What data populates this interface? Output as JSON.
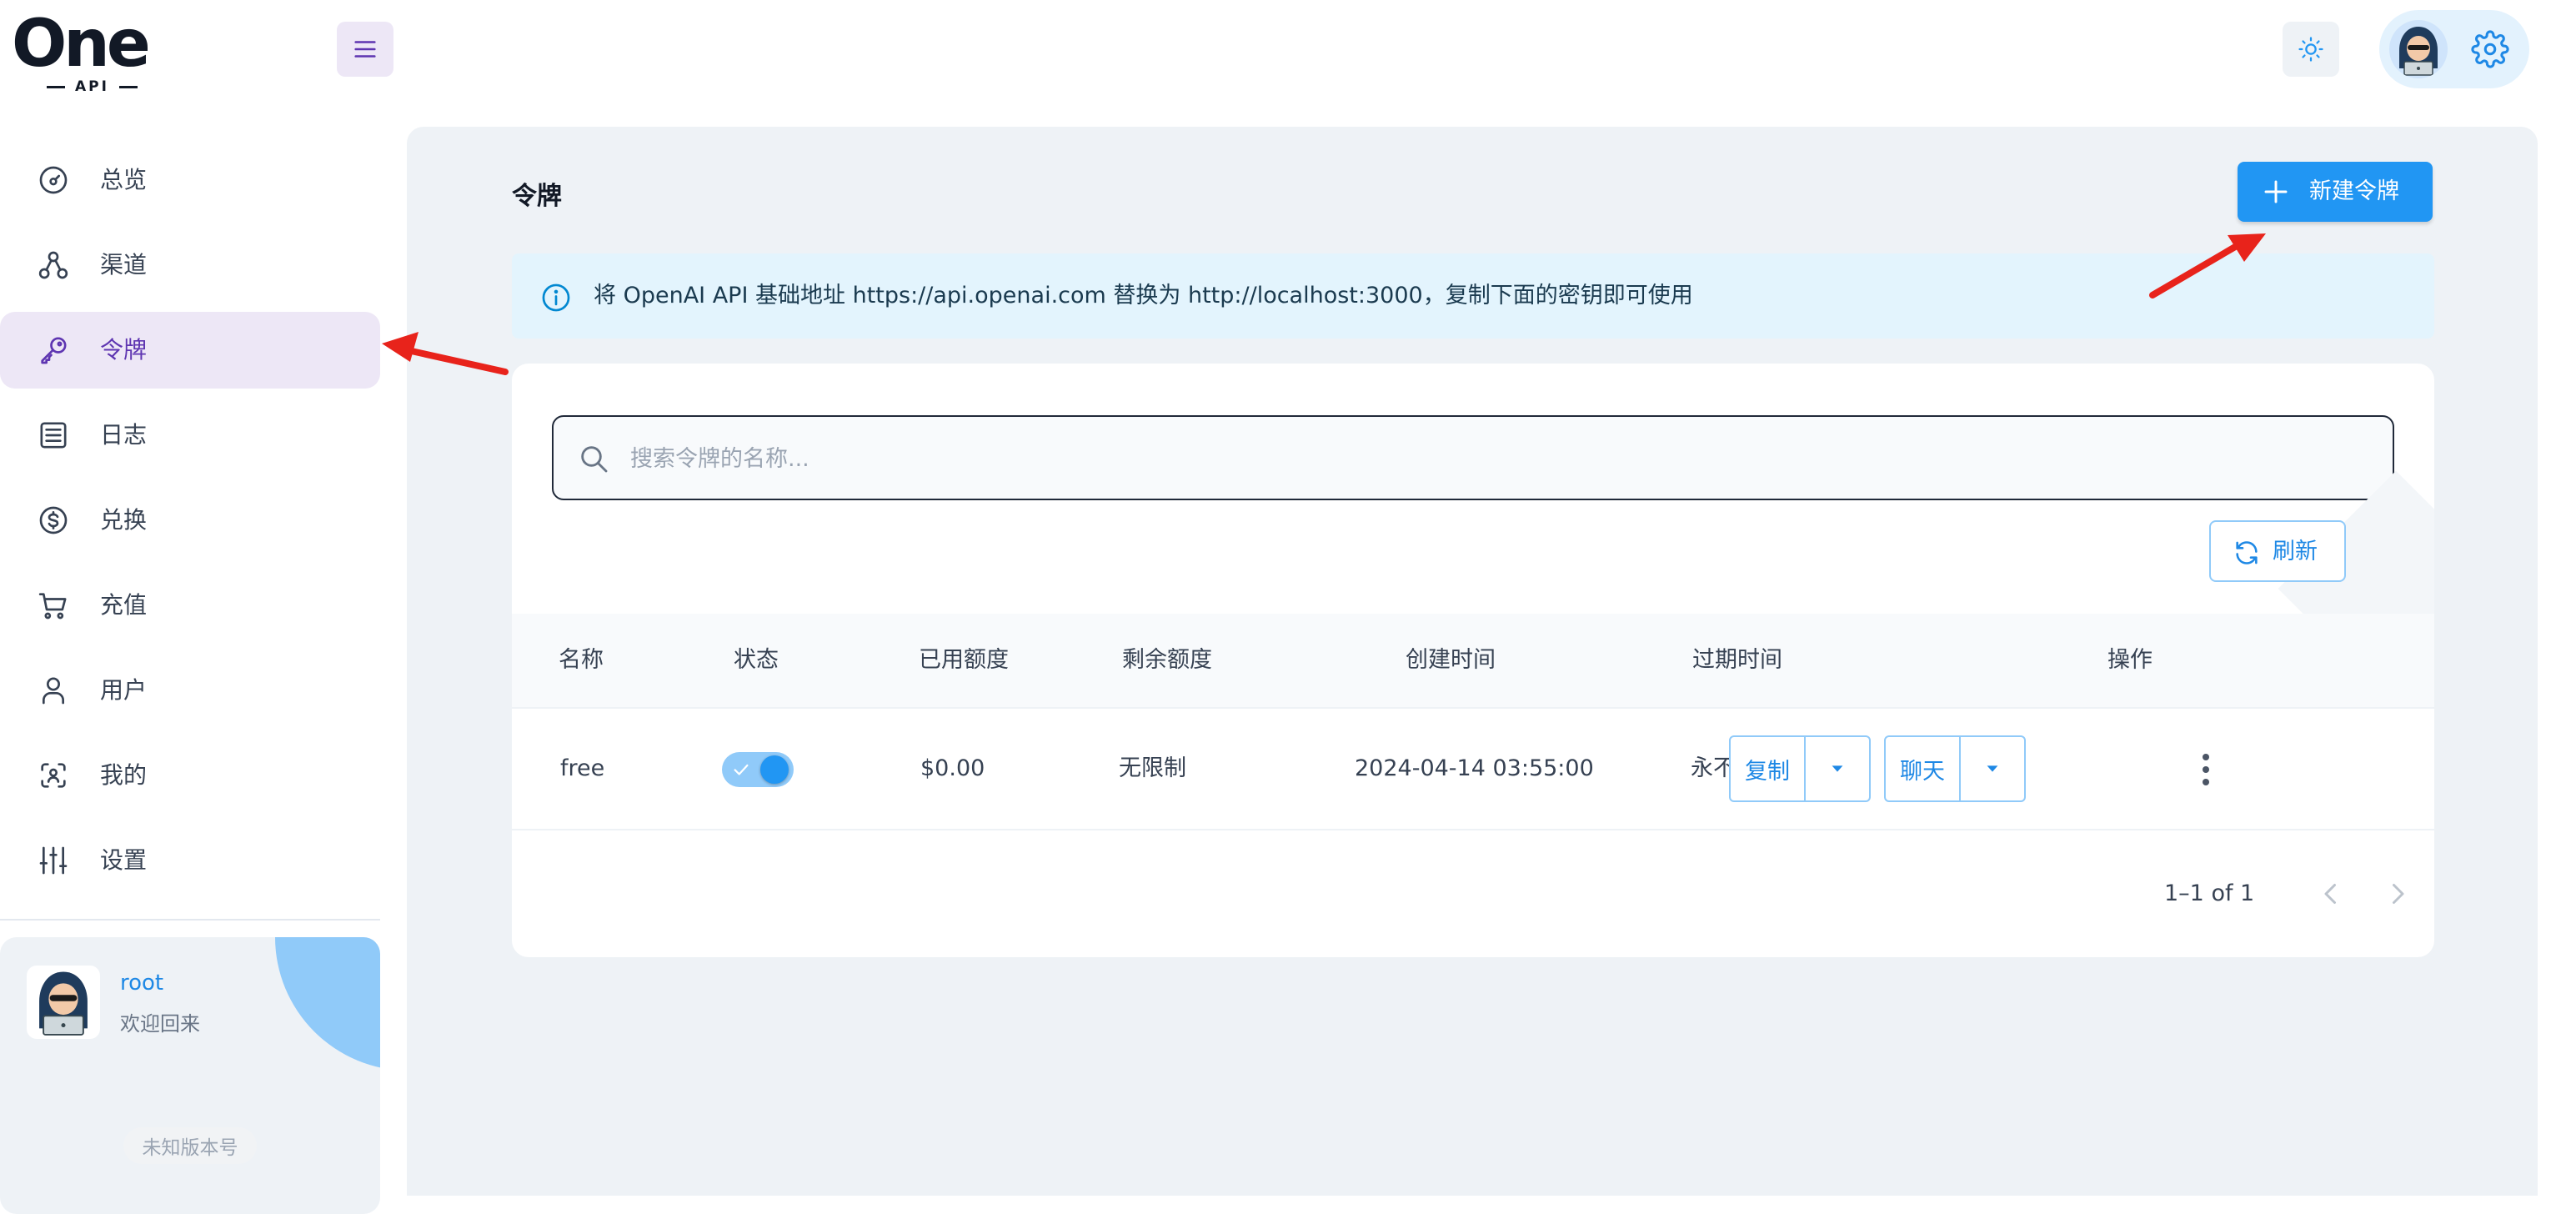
{
  "header": {
    "logo_text": "One",
    "logo_sub": "API",
    "menu_icon": "hamburger-icon",
    "theme_icon": "sun-icon",
    "settings_icon": "gear-icon"
  },
  "sidebar": {
    "items": [
      {
        "label": "总览",
        "icon": "dashboard-icon"
      },
      {
        "label": "渠道",
        "icon": "channels-icon"
      },
      {
        "label": "令牌",
        "icon": "key-icon",
        "active": true
      },
      {
        "label": "日志",
        "icon": "log-icon"
      },
      {
        "label": "兑换",
        "icon": "dollar-icon"
      },
      {
        "label": "充值",
        "icon": "cart-icon"
      },
      {
        "label": "用户",
        "icon": "user-icon"
      },
      {
        "label": "我的",
        "icon": "profile-scan-icon"
      },
      {
        "label": "设置",
        "icon": "sliders-icon"
      }
    ],
    "user": {
      "name": "root",
      "greeting": "欢迎回来"
    },
    "version": "未知版本号"
  },
  "main": {
    "title": "令牌",
    "new_button": "新建令牌",
    "alert": "将 OpenAI API 基础地址 https://api.openai.com 替换为 http://localhost:3000，复制下面的密钥即可使用",
    "search_placeholder": "搜索令牌的名称...",
    "refresh_label": "刷新",
    "table": {
      "headers": [
        "名称",
        "状态",
        "已用额度",
        "剩余额度",
        "创建时间",
        "过期时间",
        "操作"
      ],
      "rows": [
        {
          "name": "free",
          "enabled": true,
          "used": "$0.00",
          "remaining": "无限制",
          "created": "2024-04-14 03:55:00",
          "expires": "永不过期",
          "copy_label": "复制",
          "chat_label": "聊天"
        }
      ]
    },
    "pagination": "1–1 of 1"
  },
  "colors": {
    "primary": "#2196f3",
    "primary_light": "#90caf9",
    "active_bg": "#ede7f6",
    "active_text": "#5e35b1",
    "content_bg": "#eef2f6",
    "alert_bg": "#e3f4fd",
    "arrow": "#e8231b"
  }
}
